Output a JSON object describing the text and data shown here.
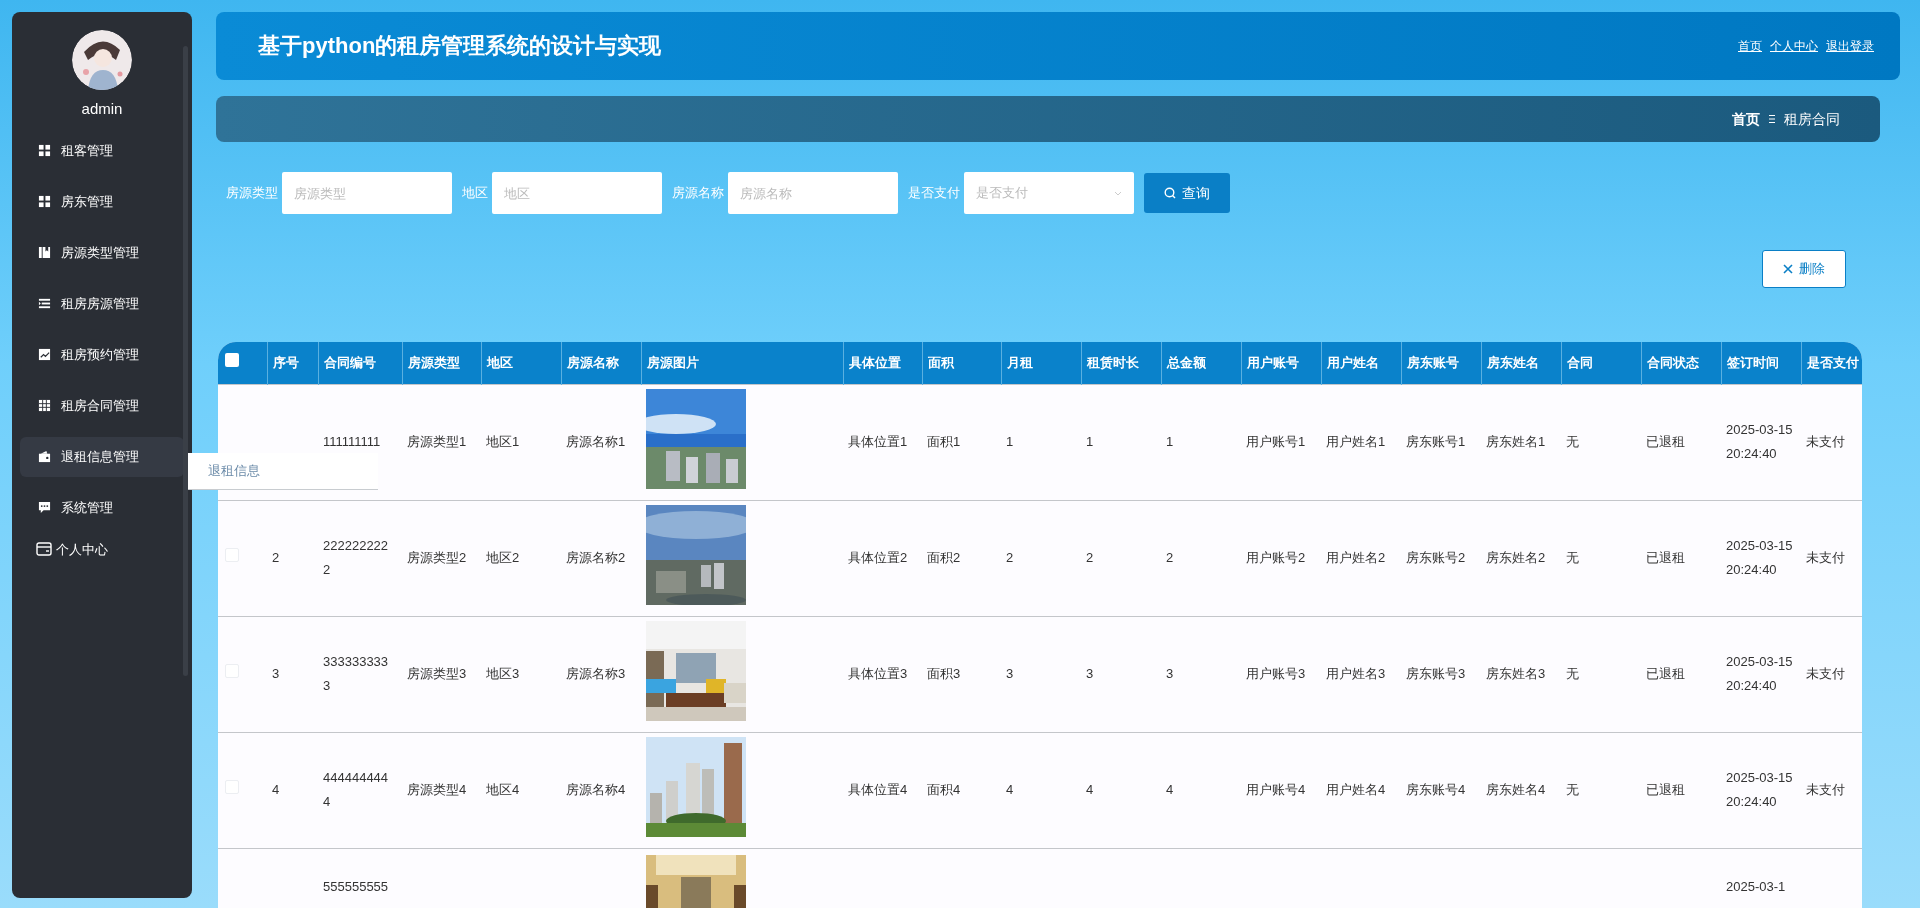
{
  "sidebar": {
    "username": "admin",
    "items": [
      {
        "label": "租客管理",
        "selected": false
      },
      {
        "label": "房东管理",
        "selected": false
      },
      {
        "label": "房源类型管理",
        "selected": false
      },
      {
        "label": "租房房源管理",
        "selected": false
      },
      {
        "label": "租房预约管理",
        "selected": false
      },
      {
        "label": "租房合同管理",
        "selected": false
      },
      {
        "label": "退租信息管理",
        "selected": true
      },
      {
        "label": "系统管理",
        "selected": false
      }
    ],
    "personal": "个人中心"
  },
  "submenu_popup": {
    "items": [
      "退租信息"
    ]
  },
  "header": {
    "title": "基于python的租房管理系统的设计与实现",
    "links": [
      "首页",
      "个人中心",
      "退出登录"
    ]
  },
  "breadcrumb": {
    "items": [
      "首页",
      "租房合同"
    ]
  },
  "search": {
    "fields": [
      {
        "label": "房源类型",
        "placeholder": "房源类型",
        "kind": "text"
      },
      {
        "label": "地区",
        "placeholder": "地区",
        "kind": "text"
      },
      {
        "label": "房源名称",
        "placeholder": "房源名称",
        "kind": "text"
      },
      {
        "label": "是否支付",
        "placeholder": "是否支付",
        "kind": "select"
      }
    ],
    "button": "查询"
  },
  "actions": {
    "delete": "删除"
  },
  "table": {
    "header_checked": false,
    "columns": [
      {
        "label": "序号",
        "kind": "text"
      },
      {
        "label": "合同编号",
        "kind": "text"
      },
      {
        "label": "房源类型",
        "kind": "text"
      },
      {
        "label": "地区",
        "kind": "text"
      },
      {
        "label": "房源名称",
        "kind": "text"
      },
      {
        "label": "房源图片"
      },
      {
        "label": "具体位置",
        "kind": "text"
      },
      {
        "label": "面积",
        "kind": "text"
      },
      {
        "label": "月租",
        "kind": "text"
      },
      {
        "label": "租赁时长",
        "kind": "text"
      },
      {
        "label": "总金额",
        "kind": "text"
      },
      {
        "label": "用户账号",
        "kind": "text"
      },
      {
        "label": "用户姓名",
        "kind": "text"
      },
      {
        "label": "房东账号",
        "kind": "text"
      },
      {
        "label": "房东姓名",
        "kind": "text"
      },
      {
        "label": "合同",
        "kind": "text"
      },
      {
        "label": "合同状态",
        "kind": "text"
      },
      {
        "label": "签订时间",
        "kind": "text"
      },
      {
        "label": "是否支付",
        "kind": "text"
      }
    ],
    "rows": [
      {
        "cells": [
          null,
          "111111111",
          "房源类型1",
          "地区1",
          "房源名称1",
          {
            "kind": "picture"
          },
          "具体位置1",
          "面积1",
          "1",
          "1",
          "1",
          "用户账号1",
          "用户姓名1",
          "房东账号1",
          "房东姓名1",
          "无",
          "已退租",
          "2025-03-15 20:24:40",
          "未支付"
        ]
      },
      {
        "checked": false,
        "cells": [
          "2",
          "2222222222",
          "房源类型2",
          "地区2",
          "房源名称2",
          {
            "kind": "picture"
          },
          "具体位置2",
          "面积2",
          "2",
          "2",
          "2",
          "用户账号2",
          "用户姓名2",
          "房东账号2",
          "房东姓名2",
          "无",
          "已退租",
          "2025-03-15 20:24:40",
          "未支付"
        ]
      },
      {
        "checked": false,
        "cells": [
          "3",
          "3333333333",
          "房源类型3",
          "地区3",
          "房源名称3",
          {
            "kind": "picture"
          },
          "具体位置3",
          "面积3",
          "3",
          "3",
          "3",
          "用户账号3",
          "用户姓名3",
          "房东账号3",
          "房东姓名3",
          "无",
          "已退租",
          "2025-03-15 20:24:40",
          "未支付"
        ]
      },
      {
        "checked": false,
        "cells": [
          "4",
          "4444444444",
          "房源类型4",
          "地区4",
          "房源名称4",
          {
            "kind": "picture"
          },
          "具体位置4",
          "面积4",
          "4",
          "4",
          "4",
          "用户账号4",
          "用户姓名4",
          "房东账号4",
          "房东姓名4",
          "无",
          "已退租",
          "2025-03-15 20:24:40",
          "未支付"
        ]
      },
      {
        "cells": [
          null,
          "555555555",
          null,
          null,
          null,
          {
            "kind": "picture"
          },
          null,
          null,
          null,
          null,
          null,
          null,
          null,
          null,
          null,
          null,
          null,
          "2025-03-1",
          null
        ]
      }
    ]
  }
}
